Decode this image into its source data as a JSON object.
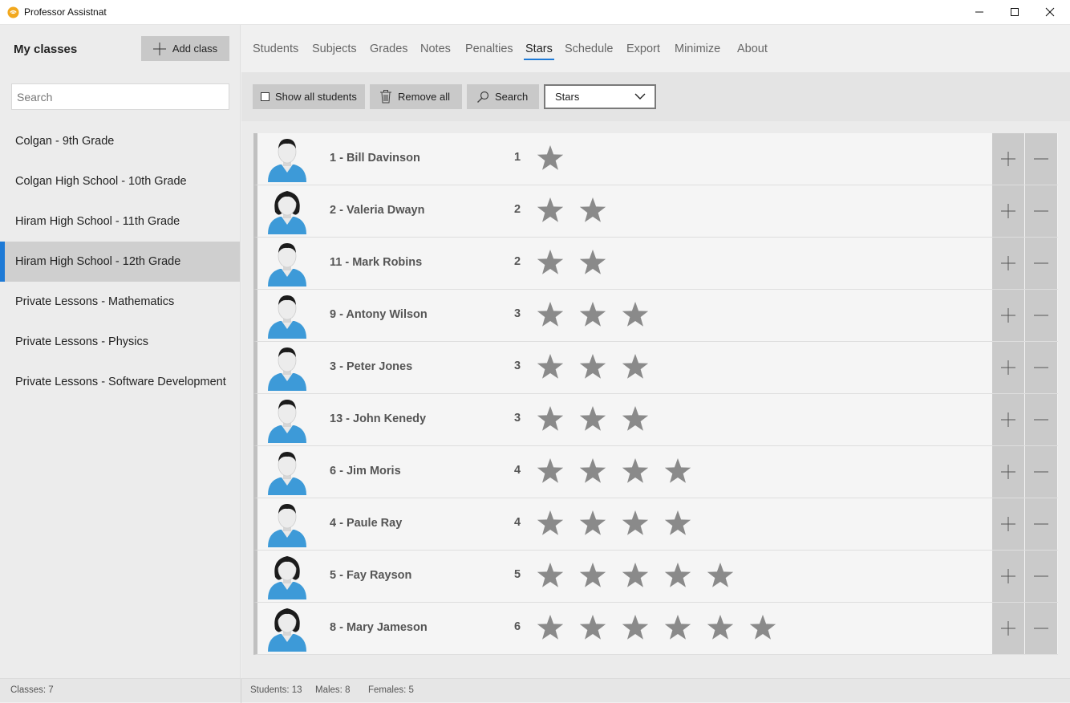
{
  "window": {
    "title": "Professor Assistnat"
  },
  "sidebar": {
    "title": "My classes",
    "add_class_label": "Add class",
    "search_placeholder": "Search",
    "classes": [
      {
        "label": "Colgan - 9th Grade",
        "selected": false
      },
      {
        "label": "Colgan High School - 10th Grade",
        "selected": false
      },
      {
        "label": "Hiram High School - 11th Grade",
        "selected": false
      },
      {
        "label": "Hiram High School - 12th Grade",
        "selected": true
      },
      {
        "label": "Private Lessons - Mathematics",
        "selected": false
      },
      {
        "label": "Private Lessons - Physics",
        "selected": false
      },
      {
        "label": "Private Lessons - Software Development",
        "selected": false
      }
    ]
  },
  "nav": {
    "tabs": [
      "Students",
      "Subjects",
      "Grades",
      "Notes",
      "Penalties",
      "Stars",
      "Schedule",
      "Export",
      "Minimize",
      "About"
    ],
    "active": "Stars"
  },
  "toolbar": {
    "show_all_label": "Show all students",
    "remove_all_label": "Remove all",
    "search_label": "Search",
    "dropdown_value": "Stars"
  },
  "students": [
    {
      "name": "1 - Bill Davinson",
      "stars": 1,
      "gender": "male"
    },
    {
      "name": "2 - Valeria Dwayn",
      "stars": 2,
      "gender": "female"
    },
    {
      "name": "11 - Mark Robins",
      "stars": 2,
      "gender": "male"
    },
    {
      "name": "9 - Antony Wilson",
      "stars": 3,
      "gender": "male"
    },
    {
      "name": "3 - Peter Jones",
      "stars": 3,
      "gender": "male"
    },
    {
      "name": "13 - John Kenedy",
      "stars": 3,
      "gender": "male"
    },
    {
      "name": "6 - Jim Moris",
      "stars": 4,
      "gender": "male"
    },
    {
      "name": "4 - Paule Ray",
      "stars": 4,
      "gender": "male"
    },
    {
      "name": "5 - Fay Rayson",
      "stars": 5,
      "gender": "female"
    },
    {
      "name": "8 - Mary Jameson",
      "stars": 6,
      "gender": "female"
    }
  ],
  "status": {
    "classes": "Classes: 7",
    "students": "Students: 13",
    "males": "Males: 8",
    "females": "Females: 5"
  },
  "colors": {
    "accent": "#1e7ad6",
    "star": "#8a8a8a",
    "avatar_shirt": "#3d9ad8"
  }
}
